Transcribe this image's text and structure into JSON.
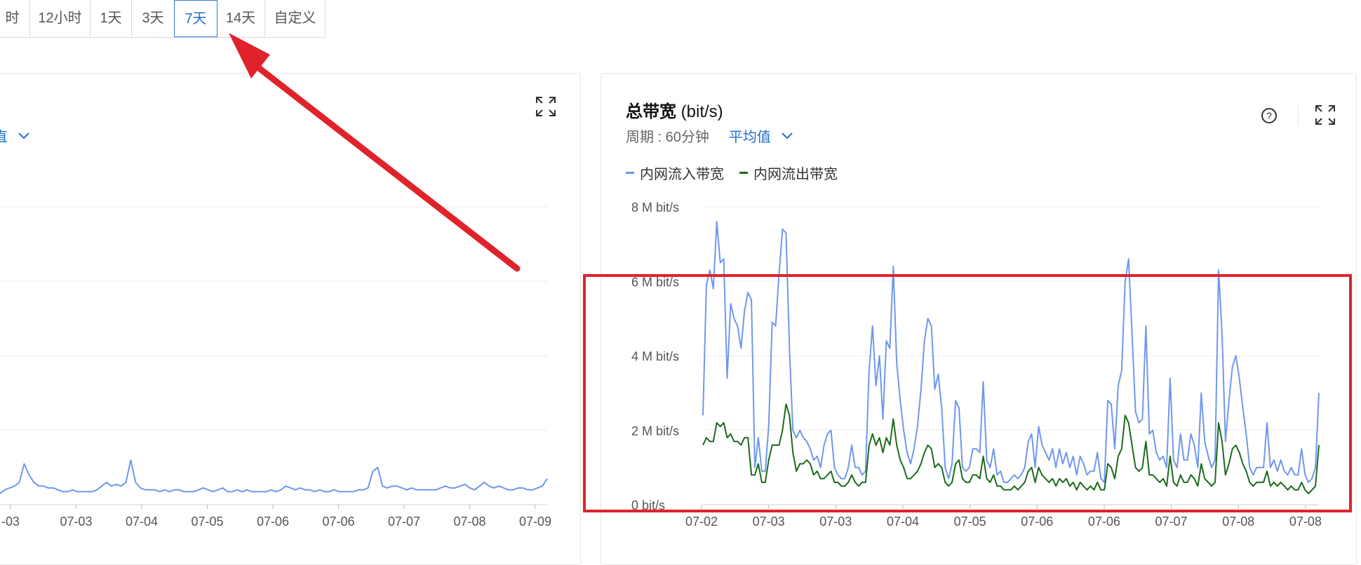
{
  "time_range": {
    "options": [
      "时",
      "12小时",
      "1天",
      "3天",
      "7天",
      "14天",
      "自定义"
    ],
    "selected": "7天"
  },
  "left_card": {
    "aggregation_partial": "直",
    "x_ticks": [
      "-03",
      "07-03",
      "07-04",
      "07-05",
      "07-06",
      "07-06",
      "07-07",
      "07-08",
      "07-09"
    ]
  },
  "right_card": {
    "title": "总带宽",
    "title_unit": "(bit/s)",
    "period_label": "周期 : 60分钟",
    "aggregation": "平均值",
    "legend": [
      {
        "name": "内网流入带宽",
        "color": "#6f97ee"
      },
      {
        "name": "内网流出带宽",
        "color": "#1c6a1c"
      }
    ]
  },
  "colors": {
    "accent": "#1f6fd1",
    "annotation_red": "#e0232b",
    "inbound": "#6f97ee",
    "outbound": "#1c6a1c"
  },
  "chart_data": [
    {
      "type": "line",
      "title": "",
      "x_ticks": [
        "-03",
        "07-03",
        "07-04",
        "07-05",
        "07-06",
        "07-06",
        "07-07",
        "07-08",
        "07-09"
      ],
      "ylim": [
        0,
        8
      ],
      "y_unit": "M bit/s",
      "grid": true,
      "series": [
        {
          "name": "",
          "values": [
            0.3,
            0.4,
            0.45,
            0.5,
            0.6,
            1.1,
            0.8,
            0.6,
            0.5,
            0.5,
            0.45,
            0.45,
            0.4,
            0.35,
            0.35,
            0.4,
            0.35,
            0.35,
            0.35,
            0.35,
            0.4,
            0.5,
            0.6,
            0.5,
            0.55,
            0.5,
            0.6,
            1.2,
            0.6,
            0.45,
            0.4,
            0.4,
            0.4,
            0.35,
            0.4,
            0.35,
            0.4,
            0.4,
            0.35,
            0.35,
            0.35,
            0.4,
            0.45,
            0.4,
            0.35,
            0.4,
            0.45,
            0.35,
            0.35,
            0.4,
            0.35,
            0.4,
            0.35,
            0.35,
            0.35,
            0.35,
            0.4,
            0.35,
            0.4,
            0.5,
            0.45,
            0.4,
            0.45,
            0.4,
            0.4,
            0.35,
            0.4,
            0.35,
            0.35,
            0.4,
            0.35,
            0.35,
            0.35,
            0.35,
            0.4,
            0.4,
            0.45,
            0.9,
            1.0,
            0.5,
            0.45,
            0.5,
            0.5,
            0.45,
            0.4,
            0.45,
            0.4,
            0.4,
            0.4,
            0.4,
            0.4,
            0.45,
            0.5,
            0.45,
            0.45,
            0.5,
            0.55,
            0.45,
            0.4,
            0.5,
            0.6,
            0.5,
            0.45,
            0.5,
            0.45,
            0.4,
            0.4,
            0.45,
            0.45,
            0.4,
            0.4,
            0.45,
            0.5,
            0.7
          ]
        }
      ]
    },
    {
      "type": "line",
      "title": "总带宽 (bit/s)",
      "x_ticks": [
        "07-02",
        "07-03",
        "07-03",
        "07-04",
        "07-05",
        "07-06",
        "07-06",
        "07-07",
        "07-08",
        "07-08"
      ],
      "y_ticks": [
        "8 M bit/s",
        "6 M bit/s",
        "4 M bit/s",
        "2 M bit/s",
        "0  bit/s"
      ],
      "ylim": [
        0,
        8
      ],
      "y_unit": "M bit/s",
      "grid": true,
      "legend_position": "top-left",
      "series": [
        {
          "name": "内网流入带宽",
          "color": "#6f97ee",
          "values": [
            2.4,
            5.9,
            6.3,
            5.8,
            7.6,
            6.5,
            6.6,
            3.4,
            5.4,
            5.0,
            4.8,
            4.2,
            5.2,
            5.7,
            5.5,
            1.0,
            1.8,
            0.9,
            0.9,
            2.1,
            4.9,
            4.8,
            6.2,
            7.4,
            7.3,
            4.2,
            2.0,
            1.8,
            2.0,
            1.8,
            1.7,
            1.5,
            1.2,
            1.3,
            1.0,
            1.6,
            1.9,
            2.0,
            1.0,
            0.8,
            0.7,
            0.7,
            1.0,
            1.6,
            1.0,
            1.0,
            0.8,
            0.9,
            3.6,
            4.8,
            3.2,
            4.0,
            2.3,
            4.4,
            4.2,
            6.4,
            3.8,
            2.8,
            2.0,
            1.4,
            1.1,
            1.5,
            2.1,
            3.1,
            4.4,
            5.0,
            4.8,
            3.1,
            3.5,
            2.6,
            1.0,
            0.7,
            1.1,
            2.8,
            2.6,
            1.0,
            0.9,
            1.0,
            1.5,
            1.5,
            1.4,
            3.3,
            1.2,
            1.0,
            1.5,
            0.8,
            0.9,
            0.6,
            0.6,
            0.7,
            0.8,
            0.7,
            0.8,
            1.0,
            1.7,
            1.9,
            1.0,
            2.1,
            1.6,
            1.4,
            1.2,
            1.5,
            1.0,
            1.5,
            1.1,
            1.4,
            1.0,
            1.3,
            0.8,
            1.3,
            1.1,
            0.8,
            0.9,
            0.9,
            1.4,
            0.7,
            0.6,
            2.8,
            2.7,
            1.5,
            3.2,
            3.6,
            6.0,
            6.6,
            4.6,
            2.5,
            2.2,
            2.3,
            4.8,
            1.9,
            2.0,
            1.4,
            1.2,
            1.3,
            1.0,
            3.4,
            1.2,
            1.0,
            1.9,
            1.2,
            1.2,
            1.9,
            1.6,
            1.0,
            3.0,
            1.7,
            1.3,
            1.0,
            1.2,
            6.3,
            4.6,
            1.7,
            2.8,
            3.7,
            4.0,
            3.4,
            2.6,
            1.9,
            1.0,
            0.8,
            1.0,
            1.0,
            1.0,
            2.2,
            1.0,
            1.2,
            0.9,
            1.2,
            0.9,
            0.8,
            1.0,
            0.8,
            0.8,
            1.5,
            0.8,
            0.6,
            0.7,
            1.0,
            3.0
          ]
        },
        {
          "name": "内网流出带宽",
          "color": "#1c6a1c",
          "values": [
            1.6,
            1.8,
            1.7,
            1.7,
            2.2,
            2.1,
            2.2,
            1.8,
            1.9,
            1.7,
            1.7,
            1.6,
            1.8,
            1.8,
            0.8,
            0.8,
            1.1,
            0.6,
            0.6,
            1.2,
            1.6,
            1.6,
            1.6,
            2.0,
            2.7,
            2.4,
            1.4,
            0.9,
            1.1,
            1.1,
            1.2,
            1.1,
            0.8,
            0.9,
            0.7,
            0.7,
            0.8,
            0.9,
            0.6,
            0.6,
            0.5,
            0.5,
            0.6,
            0.8,
            0.6,
            0.5,
            0.6,
            0.6,
            1.6,
            1.9,
            1.6,
            1.8,
            1.4,
            1.8,
            1.6,
            2.3,
            1.6,
            1.2,
            1.0,
            0.7,
            0.7,
            0.8,
            0.9,
            1.1,
            1.4,
            1.6,
            1.5,
            1.0,
            1.1,
            1.0,
            0.6,
            0.5,
            0.6,
            1.1,
            1.2,
            0.7,
            0.6,
            0.6,
            0.8,
            0.8,
            0.7,
            1.3,
            0.7,
            0.6,
            0.8,
            0.5,
            0.5,
            0.4,
            0.4,
            0.4,
            0.5,
            0.4,
            0.5,
            0.6,
            0.9,
            1.0,
            0.6,
            1.0,
            0.8,
            0.7,
            0.6,
            0.7,
            0.5,
            0.7,
            0.6,
            0.7,
            0.5,
            0.6,
            0.4,
            0.6,
            0.5,
            0.4,
            0.5,
            0.4,
            0.6,
            0.4,
            0.4,
            1.1,
            1.0,
            0.7,
            1.3,
            1.5,
            2.4,
            2.2,
            1.6,
            1.0,
            0.9,
            1.0,
            1.7,
            0.8,
            0.8,
            0.7,
            0.6,
            0.7,
            0.5,
            1.3,
            0.6,
            0.5,
            0.8,
            0.6,
            0.6,
            0.8,
            0.7,
            0.5,
            1.1,
            0.7,
            0.6,
            0.5,
            0.6,
            2.2,
            1.7,
            0.8,
            1.1,
            1.5,
            1.6,
            1.4,
            1.1,
            0.9,
            0.6,
            0.5,
            0.6,
            0.6,
            0.6,
            0.9,
            0.5,
            0.6,
            0.5,
            0.6,
            0.5,
            0.4,
            0.5,
            0.4,
            0.4,
            0.6,
            0.4,
            0.3,
            0.4,
            0.5,
            1.6
          ]
        }
      ]
    }
  ]
}
